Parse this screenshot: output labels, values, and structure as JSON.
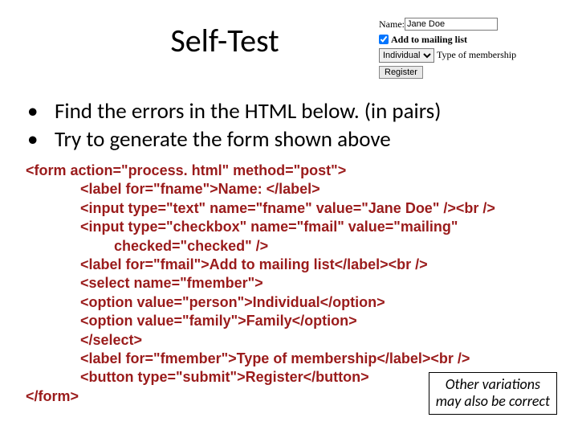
{
  "title": "Self-Test",
  "form_demo": {
    "name_label": "Name:",
    "name_value": "Jane Doe",
    "mailing_checked": true,
    "mailing_label": "Add to mailing list",
    "membership_selected": "Individual",
    "membership_label": "Type of membership",
    "register_label": "Register"
  },
  "bullets": [
    "Find the errors in the HTML below.  (in pairs)",
    "Try to generate the form shown above"
  ],
  "code_lines": [
    {
      "indent": 0,
      "text": "<form action=\"process. html\" method=\"post\">"
    },
    {
      "indent": 1,
      "text": "<label for=\"fname\">Name: </label>"
    },
    {
      "indent": 1,
      "text": "<input type=\"text\" name=\"fname\" value=\"Jane Doe\" /><br />"
    },
    {
      "indent": 1,
      "text": "<input type=\"checkbox\" name=\"fmail\" value=\"mailing\""
    },
    {
      "indent": 2,
      "text": "checked=\"checked\" />"
    },
    {
      "indent": 1,
      "text": "<label for=\"fmail\">Add to mailing list</label><br />"
    },
    {
      "indent": 1,
      "text": "<select name=\"fmember\">"
    },
    {
      "indent": 1,
      "text": "<option value=\"person\">Individual</option>"
    },
    {
      "indent": 1,
      "text": "<option value=\"family\">Family</option>"
    },
    {
      "indent": 1,
      "text": "</select>"
    },
    {
      "indent": 1,
      "text": "<label for=\"fmember\">Type of membership</label><br />"
    },
    {
      "indent": 1,
      "text": "<button type=\"submit\">Register</button>"
    },
    {
      "indent": 0,
      "text": "</form>"
    }
  ],
  "note": {
    "line1": "Other variations",
    "line2": "may also be correct"
  }
}
